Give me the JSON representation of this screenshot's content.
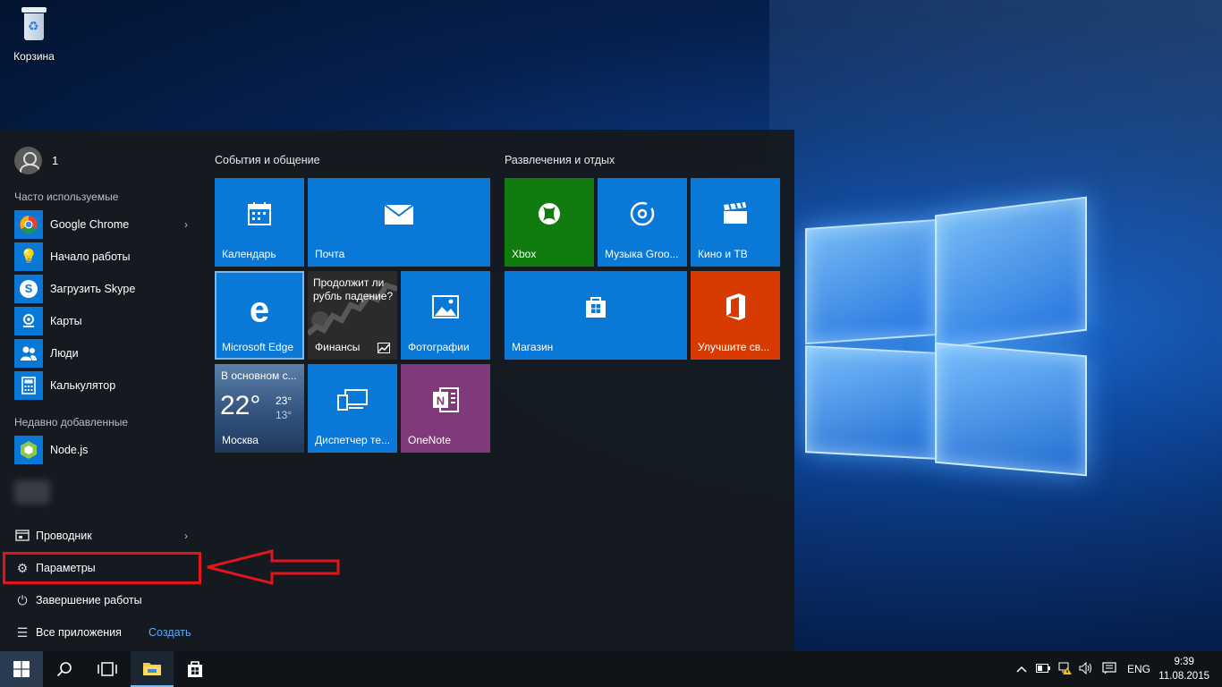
{
  "desktop": {
    "recycle_bin_label": "Корзина"
  },
  "start_menu": {
    "user_name": "1",
    "frequent_title": "Часто используемые",
    "frequent_apps": [
      {
        "label": "Google Chrome",
        "icon": "chrome-icon",
        "has_arrow": true
      },
      {
        "label": "Начало работы",
        "icon": "lightbulb-icon"
      },
      {
        "label": "Загрузить Skype",
        "icon": "skype-icon"
      },
      {
        "label": "Карты",
        "icon": "maps-icon"
      },
      {
        "label": "Люди",
        "icon": "people-icon"
      },
      {
        "label": "Калькулятор",
        "icon": "calculator-icon"
      }
    ],
    "recent_title": "Недавно добавленные",
    "recent_apps": [
      {
        "label": "Node.js",
        "icon": "nodejs-icon"
      }
    ],
    "explorer_label": "Проводник",
    "settings_label": "Параметры",
    "shutdown_label": "Завершение работы",
    "all_apps_label": "Все приложения",
    "create_label": "Создать",
    "group1_title": "События и общение",
    "group2_title": "Развлечения и отдых",
    "tiles": {
      "calendar": "Календарь",
      "mail": "Почта",
      "edge": "Microsoft Edge",
      "finance": "Финансы",
      "finance_headline": "Продолжит ли рубль падение?",
      "photos": "Фотографии",
      "weather_condition": "В основном с...",
      "weather_temp": "22°",
      "weather_high": "23°",
      "weather_low": "13°",
      "weather_city": "Москва",
      "devices": "Диспетчер те...",
      "onenote": "OneNote",
      "xbox": "Xbox",
      "music": "Музыка Groo...",
      "movies": "Кино и ТВ",
      "store": "Магазин",
      "office": "Улучшите св..."
    }
  },
  "taskbar": {
    "language": "ENG",
    "time": "9:39",
    "date": "11.08.2015"
  }
}
